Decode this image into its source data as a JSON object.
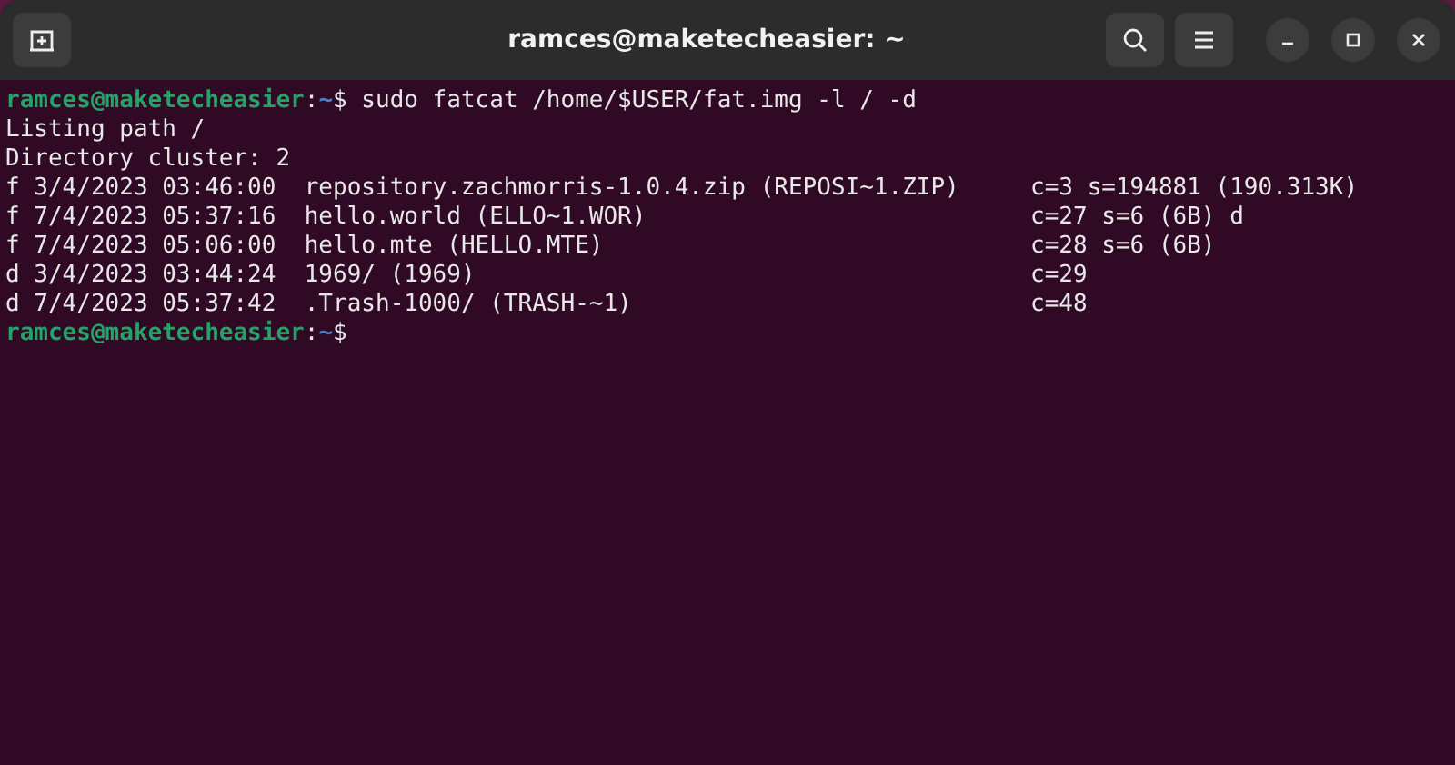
{
  "window": {
    "title": "ramces@maketecheasier: ~"
  },
  "terminal": {
    "lines": [
      {
        "kind": "prompt",
        "user_host": "ramces@maketecheasier",
        "separator": ":",
        "path": "~",
        "symbol": "$",
        "command": "sudo fatcat /home/$USER/fat.img -l / -d"
      },
      {
        "kind": "output",
        "text": "Listing path /"
      },
      {
        "kind": "output",
        "text": "Directory cluster: 2"
      },
      {
        "kind": "entry",
        "entry": "f 3/4/2023 03:46:00  repository.zachmorris-1.0.4.zip (REPOSI~1.ZIP)",
        "info": "c=3 s=194881 (190.313K)"
      },
      {
        "kind": "entry",
        "entry": "f 7/4/2023 05:37:16  hello.world (ELLO~1.WOR)",
        "info": "c=27 s=6 (6B) d"
      },
      {
        "kind": "entry",
        "entry": "f 7/4/2023 05:06:00  hello.mte (HELLO.MTE)",
        "info": "c=28 s=6 (6B)"
      },
      {
        "kind": "entry",
        "entry": "d 3/4/2023 03:44:24  1969/ (1969)",
        "info": "c=29"
      },
      {
        "kind": "entry",
        "entry": "d 7/4/2023 05:37:42  .Trash-1000/ (TRASH-~1)",
        "info": "c=48"
      },
      {
        "kind": "prompt",
        "user_host": "ramces@maketecheasier",
        "separator": ":",
        "path": "~",
        "symbol": "$"
      }
    ]
  }
}
